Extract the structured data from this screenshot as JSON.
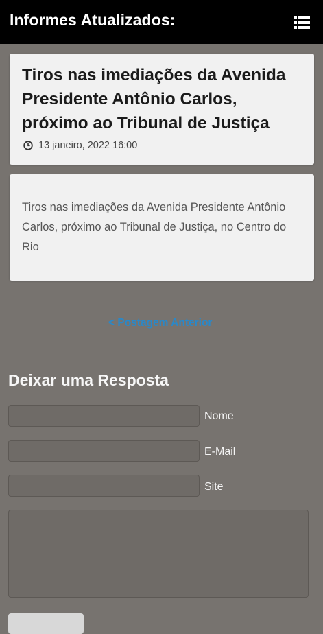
{
  "appbar": {
    "title": "Informes Atualizados:",
    "menu_icon": "list-menu-icon"
  },
  "post": {
    "title": "Tiros nas imediações da Avenida Presidente Antônio Carlos, próximo ao Tribunal de Justiça",
    "date": "13 janeiro, 2022 16:00",
    "date_icon": "clock-icon",
    "body": "Tiros nas imediações da Avenida Presidente Antônio Carlos, próximo ao Tribunal de Justiça, no Centro do Rio"
  },
  "navigation": {
    "previous_label": "< Postagem Anterior"
  },
  "reply": {
    "heading": "Deixar uma Resposta",
    "name_label": "Nome",
    "name_value": "",
    "email_label": "E-Mail",
    "email_value": "",
    "site_label": "Site",
    "site_value": "",
    "message_value": ""
  },
  "colors": {
    "appbar_bg": "#000000",
    "page_bg": "#77736f",
    "card_bg": "#f1f1f1",
    "link": "#2a88c8"
  }
}
